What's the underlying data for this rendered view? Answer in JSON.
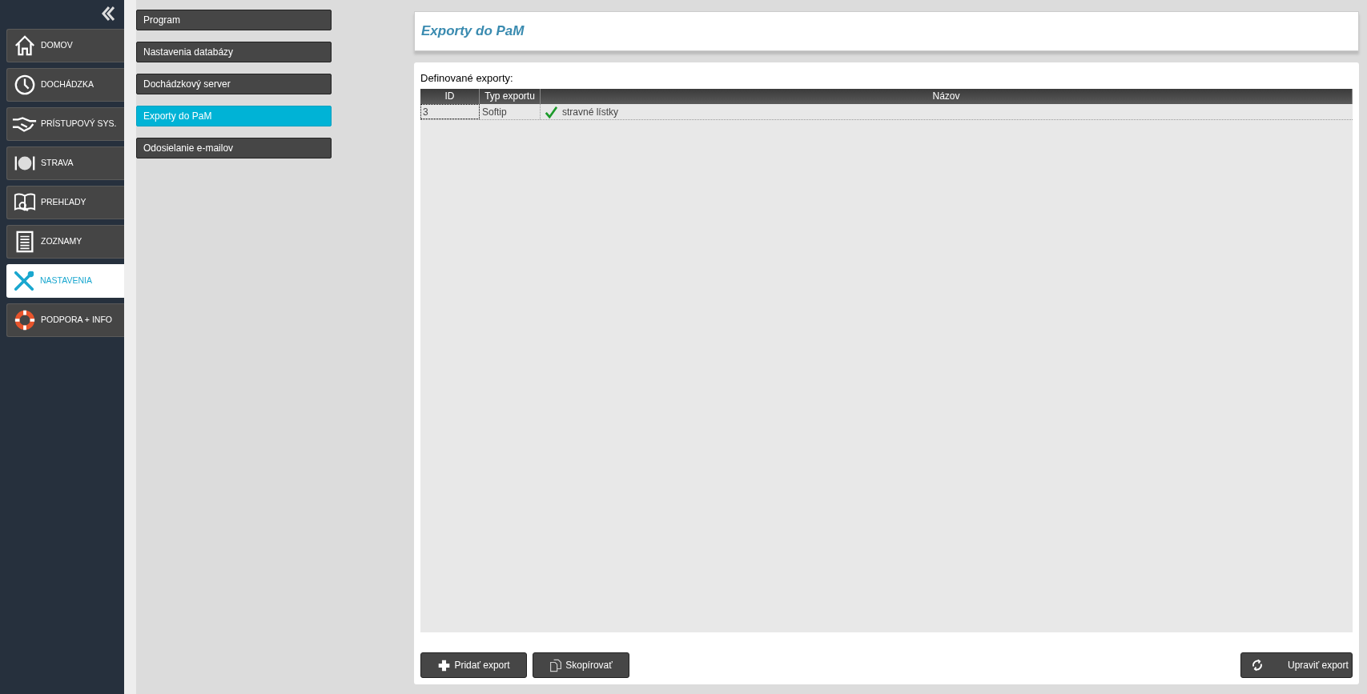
{
  "sidebar": {
    "items": [
      {
        "kind": "home",
        "label": "DOMOV",
        "selected": false
      },
      {
        "kind": "clock",
        "label": "DOCHÁDZKA",
        "selected": false
      },
      {
        "kind": "handshake",
        "label": "PRÍSTUPOVÝ SYS.",
        "selected": false
      },
      {
        "kind": "plate",
        "label": "STRAVA",
        "selected": false
      },
      {
        "kind": "book",
        "label": "PREHĽADY",
        "selected": false
      },
      {
        "kind": "list",
        "label": "ZOZNAMY",
        "selected": false
      },
      {
        "kind": "tools",
        "label": "NASTAVENIA",
        "selected": true
      },
      {
        "kind": "ring",
        "label": "PODPORA + INFO",
        "selected": false
      }
    ]
  },
  "settings_menu": [
    {
      "label": "Program",
      "selected": false
    },
    {
      "label": "Nastavenia databázy",
      "selected": false
    },
    {
      "label": "Dochádzkový server",
      "selected": false
    },
    {
      "label": "Exporty do PaM",
      "selected": true
    },
    {
      "label": "Odosielanie e-mailov",
      "selected": false
    }
  ],
  "page_title": "Exporty do PaM",
  "table": {
    "caption": "Definované exporty:",
    "columns": [
      "ID",
      "Typ exportu",
      "Názov"
    ],
    "rows": [
      {
        "id": "3",
        "type": "Softip",
        "active": true,
        "name": "stravné lístky"
      }
    ]
  },
  "buttons": [
    {
      "kind": "plus",
      "label": "Pridať export"
    },
    {
      "kind": "copy",
      "label": "Skopírovať"
    },
    {
      "kind": "refresh",
      "label": "Upraviť export"
    }
  ]
}
